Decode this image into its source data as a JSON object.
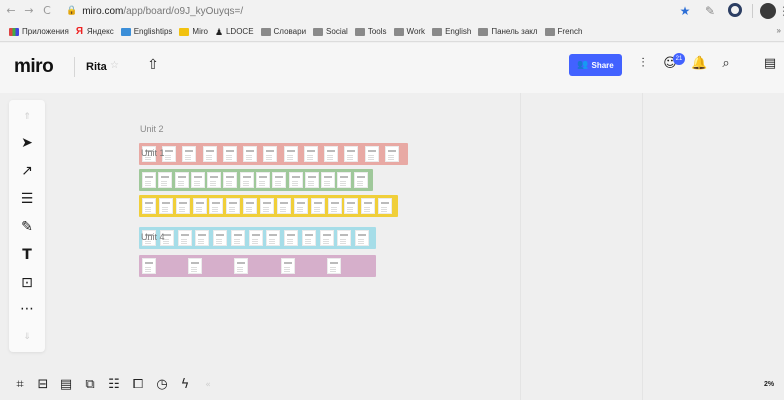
{
  "browser": {
    "back_glyph": "←",
    "forward_glyph": "→",
    "reload_glyph": "C",
    "url_host": "miro.com",
    "url_path": "/app/board/o9J_kyOuyqs=/",
    "icons": [
      "lock-icon",
      "star-icon",
      "pen-icon",
      "opera-icon",
      "avatar",
      "kebab-icon"
    ],
    "bookmarks": [
      {
        "label": "Приложения",
        "icon": "apps"
      },
      {
        "label": "Яндекс",
        "icon": "yandex"
      },
      {
        "label": "Englishtips",
        "icon": "et"
      },
      {
        "label": "Miro",
        "icon": "miro"
      },
      {
        "label": "LDOCE",
        "icon": "ldoce"
      },
      {
        "label": "Словари",
        "icon": "folder"
      },
      {
        "label": "Social",
        "icon": "folder"
      },
      {
        "label": "Tools",
        "icon": "folder"
      },
      {
        "label": "Work",
        "icon": "folder"
      },
      {
        "label": "English",
        "icon": "folder"
      },
      {
        "label": "Панель закл",
        "icon": "folder"
      },
      {
        "label": "French",
        "icon": "folder"
      }
    ],
    "bookmarks_more": "»"
  },
  "header": {
    "logo": "miro",
    "board_name": "Rita",
    "share_label": "Share",
    "notification_count": "21",
    "accent": "#4262ff"
  },
  "canvas": {
    "frame_title": "Unit 2",
    "rows": [
      {
        "color": "#e8a9a4",
        "label": "Unit 1",
        "thumbs": 13
      },
      {
        "color": "#9fc89a",
        "label": "",
        "thumbs": 14
      },
      {
        "color": "#f0cf3a",
        "label": "",
        "thumbs": 15
      },
      {
        "color": "#a6dde8",
        "label": "Unit 4",
        "thumbs": 13
      },
      {
        "color": "#d6afcb",
        "label": "",
        "thumbs": 5
      }
    ]
  },
  "toolbar": {
    "tools": [
      "select-icon",
      "connector-icon",
      "template-icon",
      "pen-icon",
      "text-icon",
      "upload-icon",
      "more-icon"
    ]
  },
  "bottombar": {
    "icons": [
      "frames-icon",
      "comment-icon",
      "notes-icon",
      "cards-icon",
      "list-icon",
      "screen-icon",
      "timer-icon",
      "reaction-icon"
    ],
    "collapse_glyph": "«",
    "zoom": "2%"
  }
}
